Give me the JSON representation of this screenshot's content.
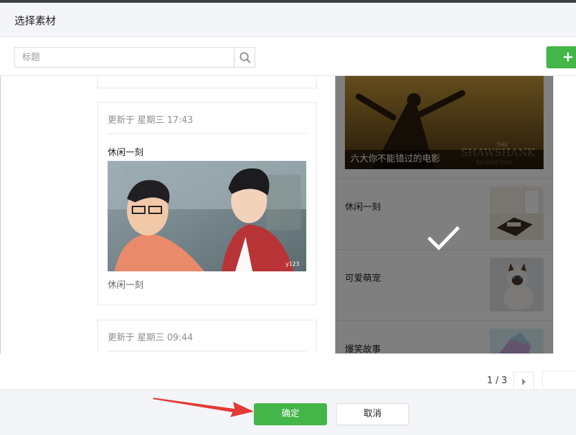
{
  "dialog": {
    "title": "选择素材"
  },
  "search": {
    "placeholder": "标题",
    "icon": "search-icon"
  },
  "toolbar": {
    "add_label": "+",
    "accent": "#44b549"
  },
  "cards": [
    {
      "updated": "更新于 星期三 17:43",
      "title": "休闲一刻",
      "digest": "休闲一刻"
    },
    {
      "updated": "更新于 星期三 09:44"
    }
  ],
  "selected": {
    "cover_title": "六大你不能错过的电影",
    "items": [
      {
        "label": "休闲一刻"
      },
      {
        "label": "可爱萌宠"
      },
      {
        "label": "爆笑故事"
      }
    ]
  },
  "pager": {
    "text": "1 / 3"
  },
  "footer": {
    "ok_label": "确定",
    "cancel_label": "取消"
  }
}
